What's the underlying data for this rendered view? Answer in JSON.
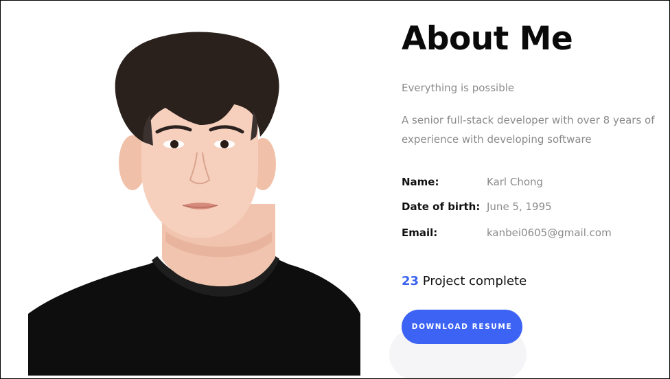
{
  "about": {
    "title": "About Me",
    "tagline": "Everything is possible",
    "bio": "A senior full-stack developer with over 8 years of experience with developing software"
  },
  "info": [
    {
      "label": "Name:",
      "value": "Karl Chong"
    },
    {
      "label": "Date of birth:",
      "value": "June 5, 1995"
    },
    {
      "label": "Email:",
      "value": "kanbei0605@gmail.com"
    }
  ],
  "projects": {
    "count": "23",
    "label": "Project complete"
  },
  "download_button": {
    "label": "DOWNLOAD RESUME"
  },
  "colors": {
    "accent": "#3d63f5",
    "muted_text": "#8a8a8a",
    "heading": "#0a0a0a"
  }
}
